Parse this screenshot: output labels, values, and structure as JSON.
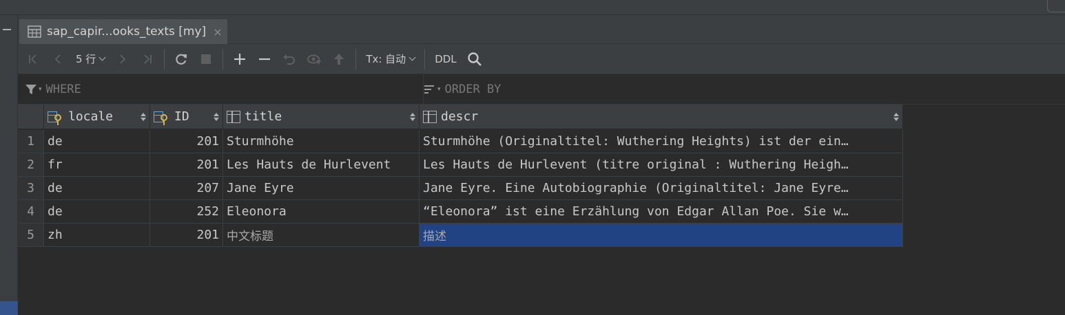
{
  "tab": {
    "title": "sap_capir...ooks_texts [my]",
    "close": "×",
    "icon": "table-icon"
  },
  "toolbar": {
    "rows_label": "5 行",
    "tx_label": "Tx: 自动",
    "ddl_label": "DDL",
    "icons": [
      "first-page-icon",
      "prev-page-icon",
      "next-page-icon",
      "last-page-icon",
      "refresh-icon",
      "stop-icon",
      "add-row-icon",
      "delete-row-icon",
      "revert-icon",
      "preview-icon",
      "submit-icon",
      "search-icon"
    ]
  },
  "filter": {
    "where_label": "WHERE",
    "order_label": "ORDER BY"
  },
  "table": {
    "columns": [
      {
        "name": "locale",
        "icon": "primary-key-column-icon"
      },
      {
        "name": "ID",
        "icon": "primary-key-column-icon"
      },
      {
        "name": "title",
        "icon": "column-icon"
      },
      {
        "name": "descr",
        "icon": "column-icon"
      }
    ],
    "rows": [
      {
        "no": "1",
        "locale": "de",
        "id": "201",
        "title": "Sturmhöhe",
        "descr": "Sturmhöhe (Originaltitel: Wuthering Heights) ist der ein…"
      },
      {
        "no": "2",
        "locale": "fr",
        "id": "201",
        "title": "Les Hauts de Hurlevent",
        "descr": "Les Hauts de Hurlevent (titre original : Wuthering Heigh…"
      },
      {
        "no": "3",
        "locale": "de",
        "id": "207",
        "title": "Jane Eyre",
        "descr": "Jane Eyre. Eine Autobiographie (Originaltitel: Jane Eyre…"
      },
      {
        "no": "4",
        "locale": "de",
        "id": "252",
        "title": "Eleonora",
        "descr": "“Eleonora” ist eine Erzählung von Edgar Allan Poe. Sie w…"
      },
      {
        "no": "5",
        "locale": "zh",
        "id": "201",
        "title": "中文标题",
        "descr": "描述"
      }
    ]
  },
  "colors": {
    "selection": "#214283",
    "panel": "#3c3f41",
    "background": "#2b2b2b"
  }
}
